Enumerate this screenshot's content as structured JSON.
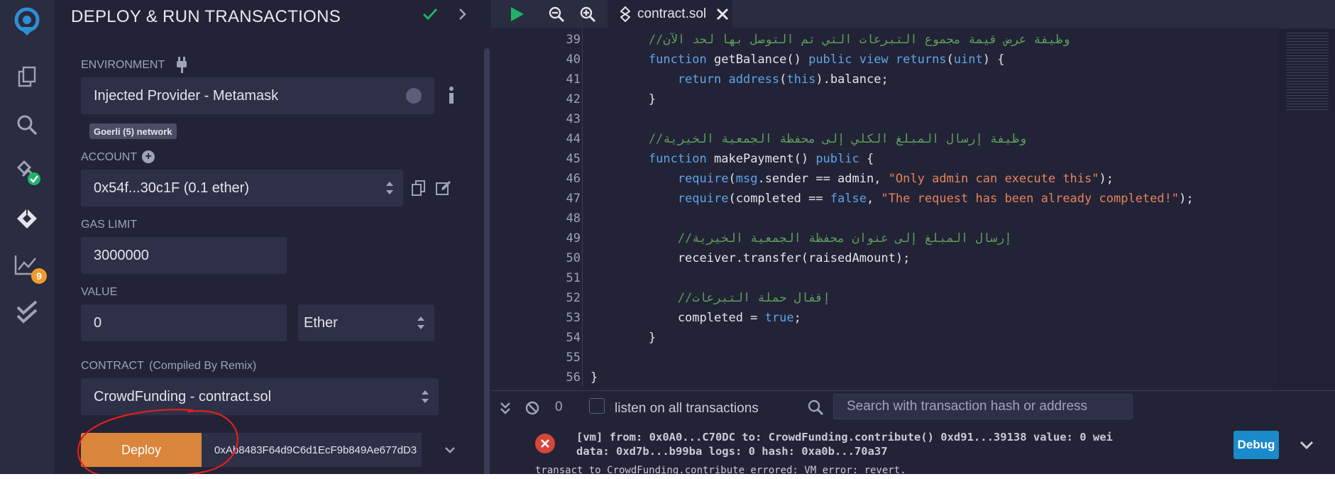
{
  "panel": {
    "title": "DEPLOY & RUN TRANSACTIONS",
    "environment": {
      "label": "ENVIRONMENT",
      "value": "Injected Provider - Metamask",
      "network_badge": "Goerli (5) network"
    },
    "account": {
      "label": "ACCOUNT",
      "value": "0x54f...30c1F (0.1 ether)"
    },
    "gas_limit": {
      "label": "GAS LIMIT",
      "value": "3000000"
    },
    "value": {
      "label": "VALUE",
      "amount": "0",
      "unit": "Ether"
    },
    "contract": {
      "label": "CONTRACT",
      "sublabel": "(Compiled By Remix)",
      "value": "CrowdFunding - contract.sol"
    },
    "deploy": {
      "button": "Deploy",
      "address_placeholder": "0xAb8483F64d9C6d1EcF9b849Ae677dD3"
    }
  },
  "iconbar": {
    "badge_count": "9"
  },
  "editor": {
    "tab_name": "contract.sol",
    "lines": [
      {
        "n": "39",
        "parts": [
          {
            "t": "        ",
            "c": ""
          },
          {
            "t": "وظيفة عرض قيمة مجموع التبرعات التي تم التوصل بها لحد الآن//",
            "c": "cm"
          }
        ]
      },
      {
        "n": "40",
        "parts": [
          {
            "t": "        ",
            "c": ""
          },
          {
            "t": "function",
            "c": "kw"
          },
          {
            "t": " getBalance() ",
            "c": ""
          },
          {
            "t": "public view returns",
            "c": "kw"
          },
          {
            "t": "(",
            "c": ""
          },
          {
            "t": "uint",
            "c": "kw"
          },
          {
            "t": ") {",
            "c": ""
          }
        ]
      },
      {
        "n": "41",
        "parts": [
          {
            "t": "            ",
            "c": ""
          },
          {
            "t": "return",
            "c": "kw"
          },
          {
            "t": " ",
            "c": ""
          },
          {
            "t": "address",
            "c": "kw"
          },
          {
            "t": "(",
            "c": ""
          },
          {
            "t": "this",
            "c": "kw"
          },
          {
            "t": ").balance;",
            "c": ""
          }
        ]
      },
      {
        "n": "42",
        "parts": [
          {
            "t": "        }",
            "c": ""
          }
        ]
      },
      {
        "n": "43",
        "parts": [
          {
            "t": "",
            "c": ""
          }
        ]
      },
      {
        "n": "44",
        "parts": [
          {
            "t": "        ",
            "c": ""
          },
          {
            "t": "وظيفة إرسال المبلغ الكلي إلى محفظة الجمعية الخيرية//",
            "c": "cm"
          }
        ]
      },
      {
        "n": "45",
        "parts": [
          {
            "t": "        ",
            "c": ""
          },
          {
            "t": "function",
            "c": "kw"
          },
          {
            "t": " makePayment() ",
            "c": ""
          },
          {
            "t": "public",
            "c": "kw"
          },
          {
            "t": " {",
            "c": ""
          }
        ]
      },
      {
        "n": "46",
        "parts": [
          {
            "t": "            ",
            "c": ""
          },
          {
            "t": "require",
            "c": "kw"
          },
          {
            "t": "(",
            "c": ""
          },
          {
            "t": "msg",
            "c": "kw"
          },
          {
            "t": ".sender == admin, ",
            "c": ""
          },
          {
            "t": "\"Only admin can execute this\"",
            "c": "str"
          },
          {
            "t": ");",
            "c": ""
          }
        ]
      },
      {
        "n": "47",
        "parts": [
          {
            "t": "            ",
            "c": ""
          },
          {
            "t": "require",
            "c": "kw"
          },
          {
            "t": "(completed == ",
            "c": ""
          },
          {
            "t": "false",
            "c": "kw"
          },
          {
            "t": ", ",
            "c": ""
          },
          {
            "t": "\"The request has been already completed!\"",
            "c": "str"
          },
          {
            "t": ");",
            "c": ""
          }
        ]
      },
      {
        "n": "48",
        "parts": [
          {
            "t": "",
            "c": ""
          }
        ]
      },
      {
        "n": "49",
        "parts": [
          {
            "t": "            ",
            "c": ""
          },
          {
            "t": "إرسال المبلغ إلى عنوان محفظة الجمعية الخيرية//",
            "c": "cm"
          }
        ]
      },
      {
        "n": "50",
        "parts": [
          {
            "t": "            receiver.transfer(raisedAmount);",
            "c": ""
          }
        ]
      },
      {
        "n": "51",
        "parts": [
          {
            "t": "",
            "c": ""
          }
        ]
      },
      {
        "n": "52",
        "parts": [
          {
            "t": "            ",
            "c": ""
          },
          {
            "t": "إقفال حملة التبرعات//",
            "c": "cm"
          }
        ]
      },
      {
        "n": "53",
        "parts": [
          {
            "t": "            completed = ",
            "c": ""
          },
          {
            "t": "true",
            "c": "kw"
          },
          {
            "t": ";",
            "c": ""
          }
        ]
      },
      {
        "n": "54",
        "parts": [
          {
            "t": "        }",
            "c": ""
          }
        ]
      },
      {
        "n": "55",
        "parts": [
          {
            "t": "",
            "c": ""
          }
        ]
      },
      {
        "n": "56",
        "parts": [
          {
            "t": "}",
            "c": ""
          }
        ]
      }
    ]
  },
  "terminal": {
    "count": "0",
    "listen_label": "listen on all transactions",
    "search_placeholder": "Search with transaction hash or address",
    "tx_line1": "[vm] from: 0x0A0...C70DC to: CrowdFunding.contribute() 0xd91...39138 value: 0 wei",
    "tx_line2": "data: 0xd7b...b99ba logs: 0 hash: 0xa0b...70a37",
    "debug_button": "Debug",
    "error_line": "transact to CrowdFunding.contribute errored: VM error: revert."
  }
}
